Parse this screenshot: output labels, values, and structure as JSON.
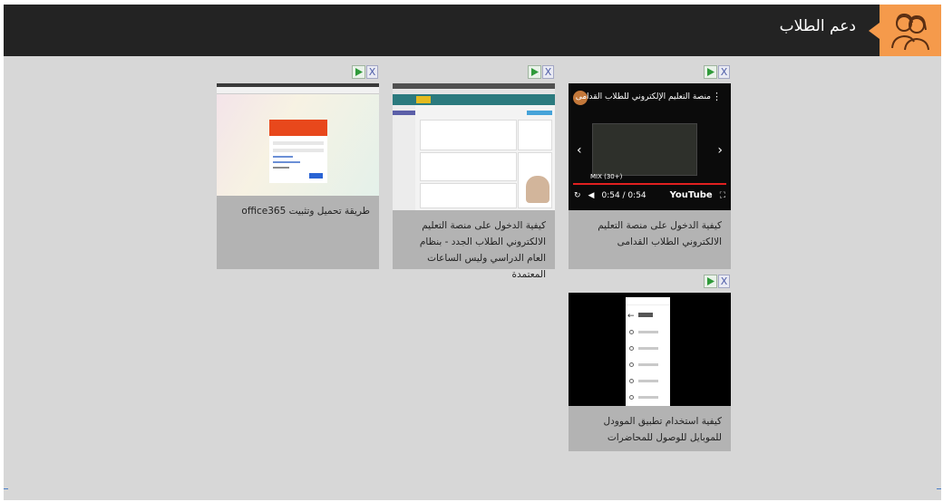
{
  "header": {
    "title": "دعم الطلاب",
    "icon": "students-icon"
  },
  "videos": [
    {
      "caption": "كيفية الدخول على منصة التعليم الالكتروني الطلاب القدامى",
      "thumbnail": {
        "type": "youtube-player",
        "title": "منصة التعليم الإلكتروني للطلاب القدامى",
        "mix_label": "MIX (30+)",
        "time": "0:54 / 0:54",
        "brand": "YouTube"
      }
    },
    {
      "caption": "كيفية الدخول على منصة التعليم الالكتروني الطلاب الجدد - بنظام العام الدراسي وليس الساعات المعتمدة",
      "thumbnail": {
        "type": "lms-screenshot"
      }
    },
    {
      "caption": "طريقة تحميل وتثبيت office365",
      "thumbnail": {
        "type": "office-login-screenshot"
      }
    },
    {
      "caption": "كيفية استخدام تطبيق الموودل للموبايل للوصول للمحاضرات",
      "thumbnail": {
        "type": "mobile-search-screenshot"
      }
    }
  ],
  "controls": {
    "close_glyph": "X"
  },
  "colors": {
    "header_bg": "#232323",
    "accent": "#f59a4b",
    "content_bg": "#d7d7d7",
    "card_bg": "#b3b3b3"
  }
}
